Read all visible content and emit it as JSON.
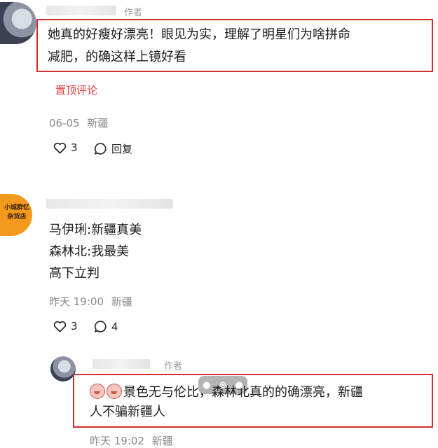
{
  "comments": [
    {
      "author_tag": "作者",
      "text_line1": "她真的好瘦好漂亮！眼见为实，理解了明星们为啥拼命",
      "text_line2": "减肥，的确这样上镜好看",
      "pin_label": "置顶评论",
      "date": "06-05",
      "location": "新疆",
      "likes": "3",
      "reply_label": "回复"
    },
    {
      "avatar_text_line1": "小城群忆",
      "avatar_text_line2": "杂货店",
      "text_lines": [
        "马伊琍:新疆真美",
        "森林北:我最美",
        "高下立判"
      ],
      "date": "昨天 19:00",
      "location": "新疆",
      "likes": "3",
      "replies": "4"
    },
    {
      "author_tag": "作者",
      "text_line1": "景色无与伦比，森林北真的的确漂亮，新疆",
      "text_line2": "人不骗新疆人",
      "date": "昨天 19:02",
      "location": "新疆"
    }
  ],
  "colors": {
    "highlight_border": "#d32f2f",
    "pin_tag": "#e23a3a",
    "meta": "#8a8a8a"
  },
  "icons": [
    "heart-icon",
    "comment-bubble-icon",
    "emoji-icon"
  ]
}
